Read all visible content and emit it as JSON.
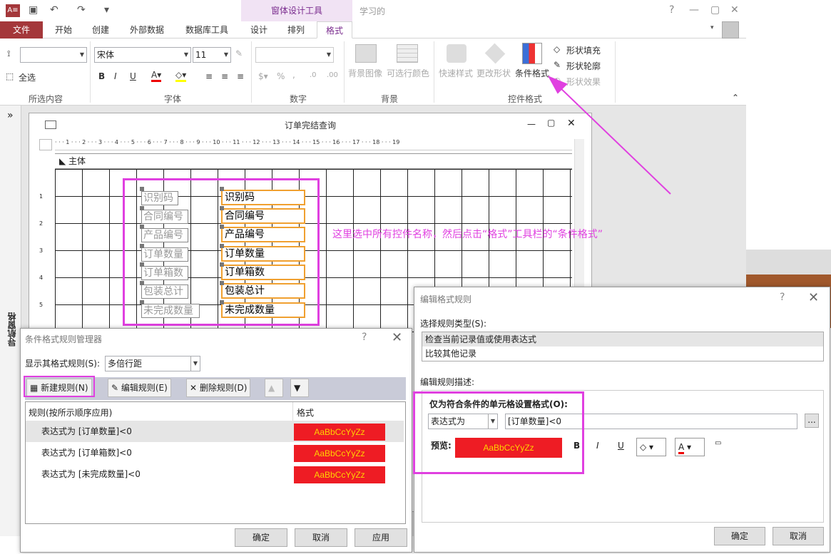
{
  "app": {
    "icon": "A≡",
    "title": "学习的",
    "contextual_group": "窗体设计工具"
  },
  "tabs": {
    "file": "文件",
    "home": "开始",
    "create": "创建",
    "external": "外部数据",
    "dbtools": "数据库工具",
    "design": "设计",
    "arrange": "排列",
    "format": "格式"
  },
  "ribbon": {
    "selection": {
      "label": "所选内容",
      "select_all": "全选"
    },
    "font": {
      "label": "字体",
      "family": "宋体",
      "size": "11"
    },
    "number": {
      "label": "数字",
      "percent": "%",
      "comma": ","
    },
    "background": {
      "label": "背景",
      "bg_image": "背景图像",
      "alt_row_color": "可选行颜色"
    },
    "control_format": {
      "label": "控件格式",
      "quick_styles": "快速样式",
      "change_shape": "更改形状",
      "conditional_format": "条件格式",
      "shape_fill": "形状填充",
      "shape_outline": "形状轮廓",
      "shape_effects": "形状效果"
    }
  },
  "nav_pane": {
    "label": "导航窗格",
    "toggle": "»"
  },
  "form_window": {
    "title": "订单完结查询",
    "section": "主体",
    "ruler": "· · · 1 · · · 2 · · · 3 · · · 4 · · · 5 · · · 6 · · · 7 · · · 8 · · · 9 · · · 10 · · · 11 · · · 12 · · · 13 · · · 14 · · · 15 · · · 16 · · · 17 · · · 18 · · · 19",
    "labels": [
      "识别码",
      "合同编号",
      "产品编号",
      "订单数量",
      "订单箱数",
      "包装总计",
      "未完成数量"
    ],
    "fields": [
      "识别码",
      "合同编号",
      "产品编号",
      "订单数量",
      "订单箱数",
      "包装总计",
      "未完成数量"
    ],
    "vruler": [
      "1",
      "2",
      "3",
      "4",
      "5"
    ]
  },
  "annotation": "这里选中所有控件名称，然后点击“格式”工具栏的“条件格式”",
  "manager_dialog": {
    "title": "条件格式规则管理器",
    "show_rules_label": "显示其格式规则(S):",
    "show_rules_value": "多倍行距",
    "new_rule": "新建规则(N)",
    "edit_rule": "编辑规则(E)",
    "delete_rule": "删除规则(D)",
    "col_rule": "规则(按所示顺序应用)",
    "col_format": "格式",
    "rules": [
      {
        "text": "表达式为 [订单数量]<0",
        "preview": "AaBbCcYyZz"
      },
      {
        "text": "表达式为 [订单箱数]<0",
        "preview": "AaBbCcYyZz"
      },
      {
        "text": "表达式为 [未完成数量]<0",
        "preview": "AaBbCcYyZz"
      }
    ],
    "ok": "确定",
    "cancel": "取消",
    "apply": "应用"
  },
  "edit_dialog": {
    "title": "编辑格式规则",
    "rule_type_label": "选择规则类型(S):",
    "rule_types": [
      "检查当前记录值或使用表达式",
      "比较其他记录"
    ],
    "desc_label": "编辑规则描述:",
    "only_label": "仅为符合条件的单元格设置格式(O):",
    "cond_type": "表达式为",
    "expression": "[订单数量]<0",
    "preview_label": "预览:",
    "preview_text": "AaBbCcYyZz",
    "bold": "B",
    "italic": "I",
    "underline": "U",
    "more": "...",
    "ok": "确定",
    "cancel": "取消"
  },
  "colors": {
    "accent": "#e040e0",
    "file_tab": "#a4373a",
    "preview_bg": "#ee1c24",
    "preview_fg": "#ffd200",
    "field_border": "#f0a030"
  }
}
